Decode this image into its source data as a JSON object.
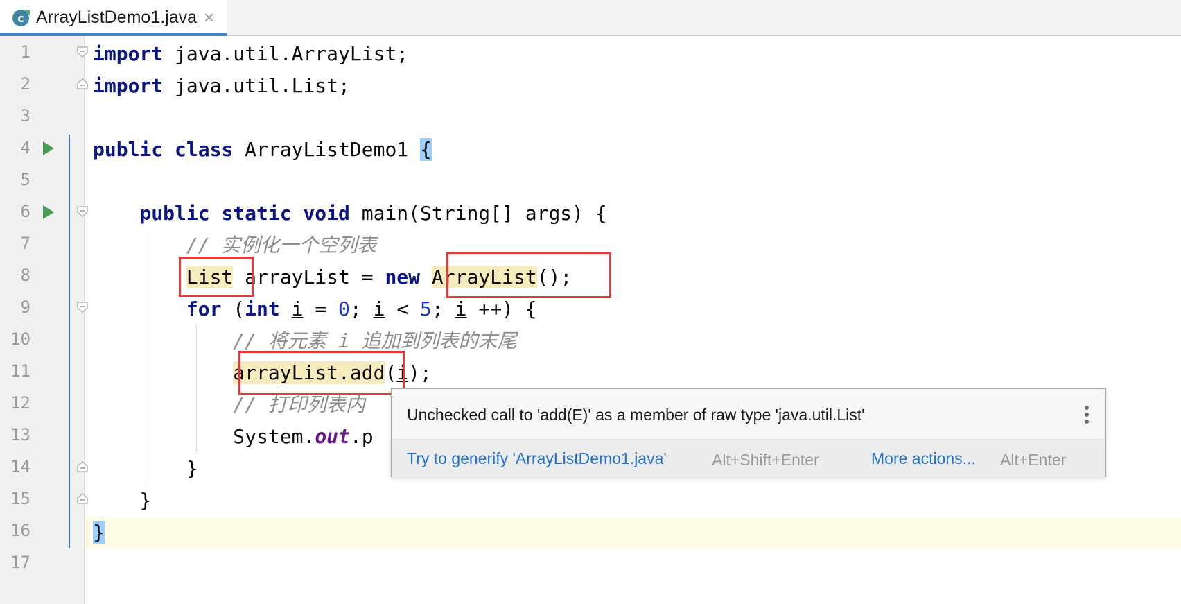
{
  "tab": {
    "title": "ArrayListDemo1.java",
    "close_glyph": "×",
    "icon": "java-class-icon"
  },
  "line_numbers": [
    "1",
    "2",
    "3",
    "4",
    "5",
    "6",
    "7",
    "8",
    "9",
    "10",
    "11",
    "12",
    "13",
    "14",
    "15",
    "16",
    "17"
  ],
  "code": {
    "l1_kw": "import",
    "l1_rest": " java.util.ArrayList;",
    "l2_kw": "import",
    "l2_rest": " java.util.List;",
    "l4_kw": "public class",
    "l4_name": " ArrayListDemo1 ",
    "l4_brace": "{",
    "l6_indent": "    ",
    "l6_kw": "public static void",
    "l6_rest": " main(String[] args) {",
    "l7_indent": "        ",
    "l7_comment": "// 实例化一个空列表",
    "l8_indent": "        ",
    "l8_type": "List",
    "l8_mid": " arrayList = ",
    "l8_new": "new",
    "l8_space": " ",
    "l8_class": "ArrayList",
    "l8_end": "();",
    "l9_indent": "        ",
    "l9_for": "for",
    "l9_p1": " (",
    "l9_int": "int",
    "l9_sp": " ",
    "l9_i1": "i",
    "l9_eq": " = ",
    "l9_zero": "0",
    "l9_semi1": "; ",
    "l9_i2": "i",
    "l9_lt": " < ",
    "l9_five": "5",
    "l9_semi2": "; ",
    "l9_i3": "i",
    "l9_end": " ++) {",
    "l10_indent": "            ",
    "l10_comment": "// 将元素 i 追加到列表的末尾",
    "l11_indent": "            ",
    "l11_call": "arrayList.add",
    "l11_p1": "(",
    "l11_i": "i",
    "l11_end": ");",
    "l12_indent": "            ",
    "l12_comment": "// 打印列表内",
    "l13_indent": "            ",
    "l13_sys": "System.",
    "l13_out": "out",
    "l13_rest": ".p",
    "l14_indent": "        ",
    "l14_brace": "}",
    "l15_indent": "    ",
    "l15_brace": "}",
    "l16_brace": "}"
  },
  "popup": {
    "message": "Unchecked call to 'add(E)' as a member of raw type 'java.util.List'",
    "action1": "Try to generify 'ArrayListDemo1.java'",
    "shortcut1": "Alt+Shift+Enter",
    "action2": "More actions...",
    "shortcut2": "Alt+Enter"
  },
  "colors": {
    "keyword": "#0a1782",
    "number": "#1a31d3",
    "comment": "#8c8c8c",
    "warning_highlight": "#f6ebbc",
    "annotation_box": "#e13b3b",
    "current_line": "#fefbe6",
    "link": "#2270c9"
  }
}
